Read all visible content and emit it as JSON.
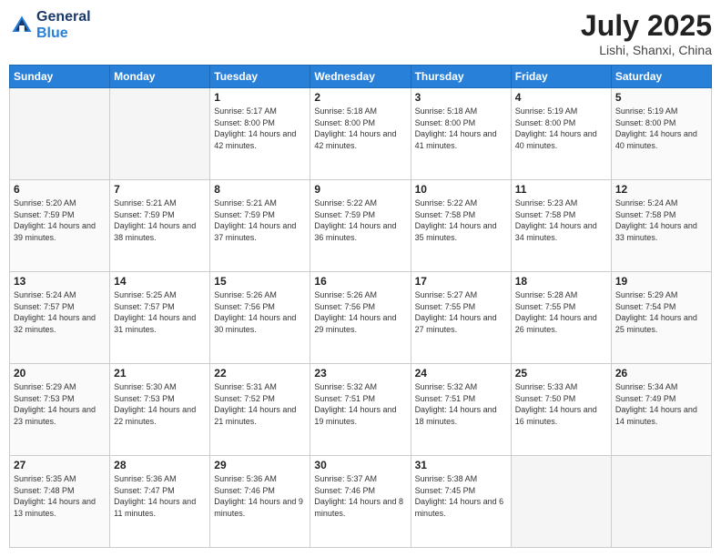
{
  "header": {
    "logo_line1": "General",
    "logo_line2": "Blue",
    "month": "July 2025",
    "location": "Lishi, Shanxi, China"
  },
  "weekdays": [
    "Sunday",
    "Monday",
    "Tuesday",
    "Wednesday",
    "Thursday",
    "Friday",
    "Saturday"
  ],
  "weeks": [
    [
      {
        "day": "",
        "sunrise": "",
        "sunset": "",
        "daylight": "",
        "empty": true
      },
      {
        "day": "",
        "sunrise": "",
        "sunset": "",
        "daylight": "",
        "empty": true
      },
      {
        "day": "1",
        "sunrise": "Sunrise: 5:17 AM",
        "sunset": "Sunset: 8:00 PM",
        "daylight": "Daylight: 14 hours and 42 minutes."
      },
      {
        "day": "2",
        "sunrise": "Sunrise: 5:18 AM",
        "sunset": "Sunset: 8:00 PM",
        "daylight": "Daylight: 14 hours and 42 minutes."
      },
      {
        "day": "3",
        "sunrise": "Sunrise: 5:18 AM",
        "sunset": "Sunset: 8:00 PM",
        "daylight": "Daylight: 14 hours and 41 minutes."
      },
      {
        "day": "4",
        "sunrise": "Sunrise: 5:19 AM",
        "sunset": "Sunset: 8:00 PM",
        "daylight": "Daylight: 14 hours and 40 minutes."
      },
      {
        "day": "5",
        "sunrise": "Sunrise: 5:19 AM",
        "sunset": "Sunset: 8:00 PM",
        "daylight": "Daylight: 14 hours and 40 minutes."
      }
    ],
    [
      {
        "day": "6",
        "sunrise": "Sunrise: 5:20 AM",
        "sunset": "Sunset: 7:59 PM",
        "daylight": "Daylight: 14 hours and 39 minutes."
      },
      {
        "day": "7",
        "sunrise": "Sunrise: 5:21 AM",
        "sunset": "Sunset: 7:59 PM",
        "daylight": "Daylight: 14 hours and 38 minutes."
      },
      {
        "day": "8",
        "sunrise": "Sunrise: 5:21 AM",
        "sunset": "Sunset: 7:59 PM",
        "daylight": "Daylight: 14 hours and 37 minutes."
      },
      {
        "day": "9",
        "sunrise": "Sunrise: 5:22 AM",
        "sunset": "Sunset: 7:59 PM",
        "daylight": "Daylight: 14 hours and 36 minutes."
      },
      {
        "day": "10",
        "sunrise": "Sunrise: 5:22 AM",
        "sunset": "Sunset: 7:58 PM",
        "daylight": "Daylight: 14 hours and 35 minutes."
      },
      {
        "day": "11",
        "sunrise": "Sunrise: 5:23 AM",
        "sunset": "Sunset: 7:58 PM",
        "daylight": "Daylight: 14 hours and 34 minutes."
      },
      {
        "day": "12",
        "sunrise": "Sunrise: 5:24 AM",
        "sunset": "Sunset: 7:58 PM",
        "daylight": "Daylight: 14 hours and 33 minutes."
      }
    ],
    [
      {
        "day": "13",
        "sunrise": "Sunrise: 5:24 AM",
        "sunset": "Sunset: 7:57 PM",
        "daylight": "Daylight: 14 hours and 32 minutes."
      },
      {
        "day": "14",
        "sunrise": "Sunrise: 5:25 AM",
        "sunset": "Sunset: 7:57 PM",
        "daylight": "Daylight: 14 hours and 31 minutes."
      },
      {
        "day": "15",
        "sunrise": "Sunrise: 5:26 AM",
        "sunset": "Sunset: 7:56 PM",
        "daylight": "Daylight: 14 hours and 30 minutes."
      },
      {
        "day": "16",
        "sunrise": "Sunrise: 5:26 AM",
        "sunset": "Sunset: 7:56 PM",
        "daylight": "Daylight: 14 hours and 29 minutes."
      },
      {
        "day": "17",
        "sunrise": "Sunrise: 5:27 AM",
        "sunset": "Sunset: 7:55 PM",
        "daylight": "Daylight: 14 hours and 27 minutes."
      },
      {
        "day": "18",
        "sunrise": "Sunrise: 5:28 AM",
        "sunset": "Sunset: 7:55 PM",
        "daylight": "Daylight: 14 hours and 26 minutes."
      },
      {
        "day": "19",
        "sunrise": "Sunrise: 5:29 AM",
        "sunset": "Sunset: 7:54 PM",
        "daylight": "Daylight: 14 hours and 25 minutes."
      }
    ],
    [
      {
        "day": "20",
        "sunrise": "Sunrise: 5:29 AM",
        "sunset": "Sunset: 7:53 PM",
        "daylight": "Daylight: 14 hours and 23 minutes."
      },
      {
        "day": "21",
        "sunrise": "Sunrise: 5:30 AM",
        "sunset": "Sunset: 7:53 PM",
        "daylight": "Daylight: 14 hours and 22 minutes."
      },
      {
        "day": "22",
        "sunrise": "Sunrise: 5:31 AM",
        "sunset": "Sunset: 7:52 PM",
        "daylight": "Daylight: 14 hours and 21 minutes."
      },
      {
        "day": "23",
        "sunrise": "Sunrise: 5:32 AM",
        "sunset": "Sunset: 7:51 PM",
        "daylight": "Daylight: 14 hours and 19 minutes."
      },
      {
        "day": "24",
        "sunrise": "Sunrise: 5:32 AM",
        "sunset": "Sunset: 7:51 PM",
        "daylight": "Daylight: 14 hours and 18 minutes."
      },
      {
        "day": "25",
        "sunrise": "Sunrise: 5:33 AM",
        "sunset": "Sunset: 7:50 PM",
        "daylight": "Daylight: 14 hours and 16 minutes."
      },
      {
        "day": "26",
        "sunrise": "Sunrise: 5:34 AM",
        "sunset": "Sunset: 7:49 PM",
        "daylight": "Daylight: 14 hours and 14 minutes."
      }
    ],
    [
      {
        "day": "27",
        "sunrise": "Sunrise: 5:35 AM",
        "sunset": "Sunset: 7:48 PM",
        "daylight": "Daylight: 14 hours and 13 minutes."
      },
      {
        "day": "28",
        "sunrise": "Sunrise: 5:36 AM",
        "sunset": "Sunset: 7:47 PM",
        "daylight": "Daylight: 14 hours and 11 minutes."
      },
      {
        "day": "29",
        "sunrise": "Sunrise: 5:36 AM",
        "sunset": "Sunset: 7:46 PM",
        "daylight": "Daylight: 14 hours and 9 minutes."
      },
      {
        "day": "30",
        "sunrise": "Sunrise: 5:37 AM",
        "sunset": "Sunset: 7:46 PM",
        "daylight": "Daylight: 14 hours and 8 minutes."
      },
      {
        "day": "31",
        "sunrise": "Sunrise: 5:38 AM",
        "sunset": "Sunset: 7:45 PM",
        "daylight": "Daylight: 14 hours and 6 minutes."
      },
      {
        "day": "",
        "sunrise": "",
        "sunset": "",
        "daylight": "",
        "empty": true
      },
      {
        "day": "",
        "sunrise": "",
        "sunset": "",
        "daylight": "",
        "empty": true
      }
    ]
  ]
}
